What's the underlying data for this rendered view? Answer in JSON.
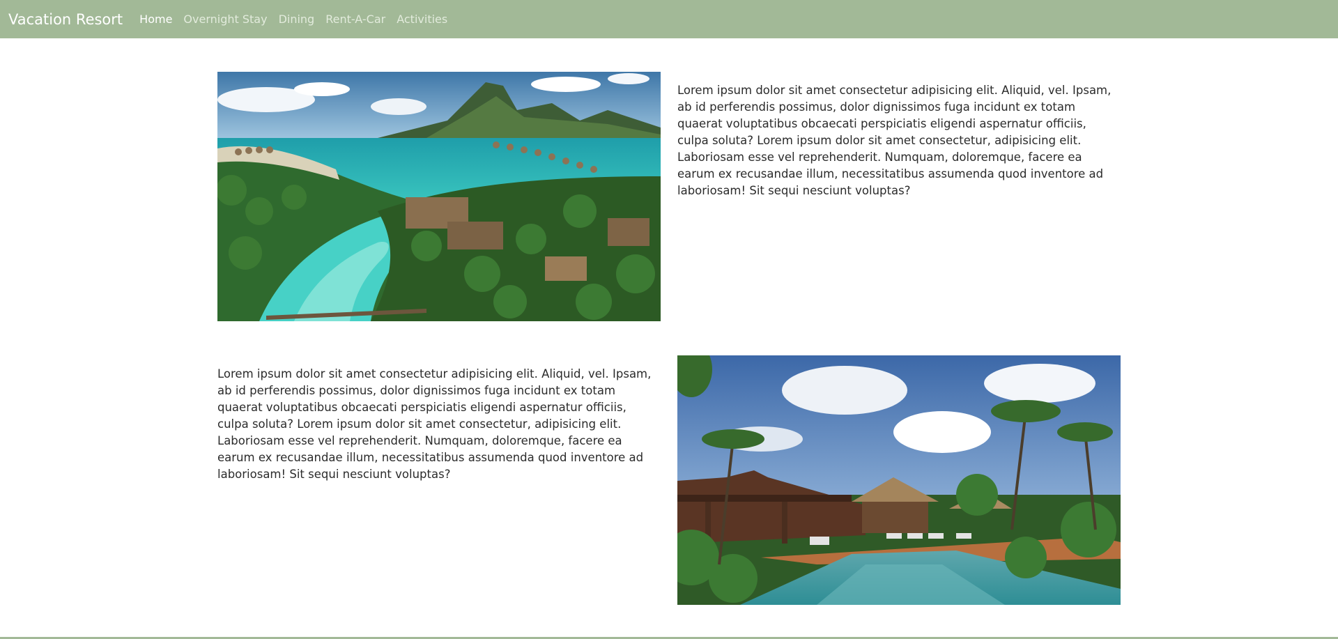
{
  "nav": {
    "brand": "Vacation Resort",
    "links": [
      {
        "label": "Home",
        "active": true
      },
      {
        "label": "Overnight Stay",
        "active": false
      },
      {
        "label": "Dining",
        "active": false
      },
      {
        "label": "Rent-A-Car",
        "active": false
      },
      {
        "label": "Activities",
        "active": false
      }
    ]
  },
  "sections": [
    {
      "image": "lagoon-aerial-photo",
      "text": "Lorem ipsum dolor sit amet consectetur adipisicing elit. Aliquid, vel. Ipsam, ab id perferendis possimus, dolor dignissimos fuga incidunt ex totam quaerat voluptatibus obcaecati perspiciatis eligendi aspernatur officiis, culpa soluta? Lorem ipsum dolor sit amet consectetur, adipisicing elit. Laboriosam esse vel reprehenderit. Numquam, doloremque, facere ea earum ex recusandae illum, necessitatibus assumenda quod inventore ad laboriosam! Sit sequi nesciunt voluptas?"
    },
    {
      "image": "resort-pool-photo",
      "text": "Lorem ipsum dolor sit amet consectetur adipisicing elit. Aliquid, vel. Ipsam, ab id perferendis possimus, dolor dignissimos fuga incidunt ex totam quaerat voluptatibus obcaecati perspiciatis eligendi aspernatur officiis, culpa soluta? Lorem ipsum dolor sit amet consectetur, adipisicing elit. Laboriosam esse vel reprehenderit. Numquam, doloremque, facere ea earum ex recusandae illum, necessitatibus assumenda quod inventore ad laboriosam! Sit sequi nesciunt voluptas?"
    }
  ],
  "colors": {
    "navbar": "#a2b997",
    "nav_active": "#ffffff",
    "nav_inactive": "#e2ebdc",
    "body_text": "#2b2b2b"
  }
}
